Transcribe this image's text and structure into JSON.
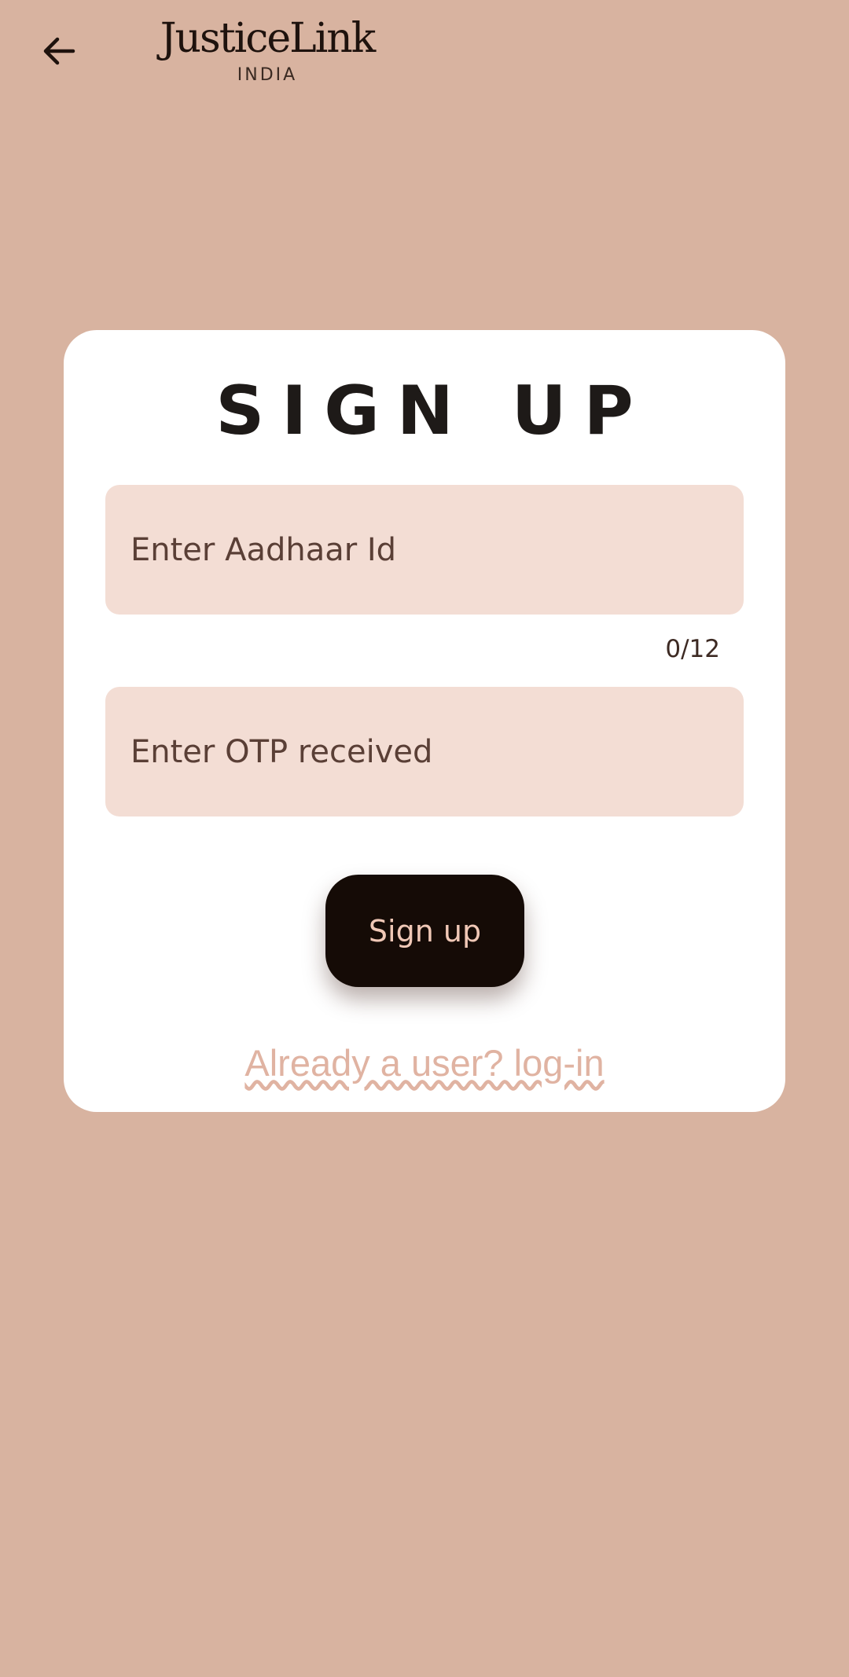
{
  "header": {
    "logo_title": "JusticeLink",
    "logo_subtitle": "INDIA",
    "back_icon": "arrow-left-icon"
  },
  "card": {
    "title": "SIGN UP",
    "aadhaar": {
      "placeholder": "Enter Aadhaar Id",
      "value": "",
      "counter": "0/12"
    },
    "otp": {
      "placeholder": "Enter OTP received",
      "value": ""
    },
    "signup_label": "Sign up",
    "login_link": "Already a user? log-in"
  },
  "colors": {
    "background": "#d8b3a0",
    "card": "#ffffff",
    "field": "#f3ddd4",
    "button": "#150b06",
    "button_text": "#f0c8b6",
    "link": "#e0b3a2"
  }
}
